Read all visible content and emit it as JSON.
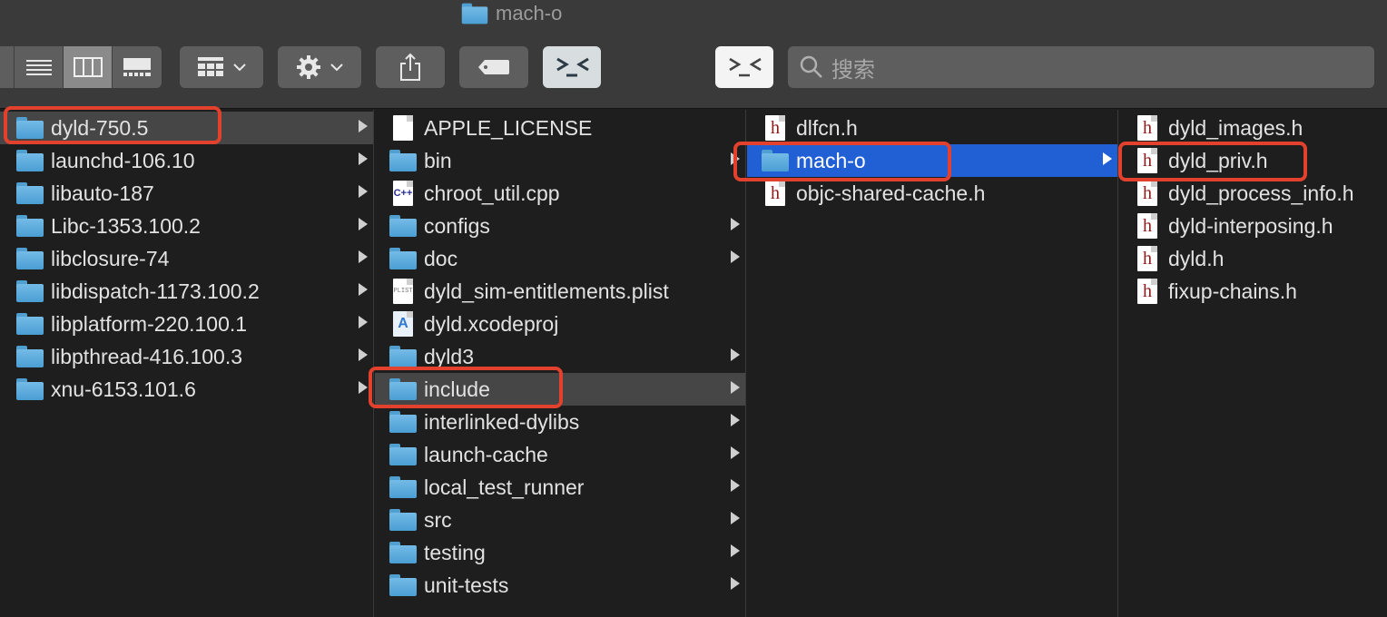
{
  "window": {
    "title": "mach-o"
  },
  "search": {
    "placeholder": "搜索"
  },
  "columns": [
    {
      "items": [
        {
          "label": "dyld-750.5",
          "kind": "folder",
          "state": "grey"
        },
        {
          "label": "launchd-106.10",
          "kind": "folder"
        },
        {
          "label": "libauto-187",
          "kind": "folder"
        },
        {
          "label": "Libc-1353.100.2",
          "kind": "folder"
        },
        {
          "label": "libclosure-74",
          "kind": "folder"
        },
        {
          "label": "libdispatch-1173.100.2",
          "kind": "folder"
        },
        {
          "label": "libplatform-220.100.1",
          "kind": "folder"
        },
        {
          "label": "libpthread-416.100.3",
          "kind": "folder"
        },
        {
          "label": "xnu-6153.101.6",
          "kind": "folder"
        }
      ]
    },
    {
      "items": [
        {
          "label": "APPLE_LICENSE",
          "kind": "file"
        },
        {
          "label": "bin",
          "kind": "folder"
        },
        {
          "label": "chroot_util.cpp",
          "kind": "cpp"
        },
        {
          "label": "configs",
          "kind": "folder"
        },
        {
          "label": "doc",
          "kind": "folder"
        },
        {
          "label": "dyld_sim-entitlements.plist",
          "kind": "plist"
        },
        {
          "label": "dyld.xcodeproj",
          "kind": "xcode"
        },
        {
          "label": "dyld3",
          "kind": "folder"
        },
        {
          "label": "include",
          "kind": "folder",
          "state": "grey"
        },
        {
          "label": "interlinked-dylibs",
          "kind": "folder"
        },
        {
          "label": "launch-cache",
          "kind": "folder"
        },
        {
          "label": "local_test_runner",
          "kind": "folder"
        },
        {
          "label": "src",
          "kind": "folder"
        },
        {
          "label": "testing",
          "kind": "folder"
        },
        {
          "label": "unit-tests",
          "kind": "folder"
        }
      ]
    },
    {
      "items": [
        {
          "label": "dlfcn.h",
          "kind": "header"
        },
        {
          "label": "mach-o",
          "kind": "folder",
          "state": "blue"
        },
        {
          "label": "objc-shared-cache.h",
          "kind": "header"
        }
      ]
    },
    {
      "items": [
        {
          "label": "dyld_images.h",
          "kind": "header"
        },
        {
          "label": "dyld_priv.h",
          "kind": "header"
        },
        {
          "label": "dyld_process_info.h",
          "kind": "header"
        },
        {
          "label": "dyld-interposing.h",
          "kind": "header"
        },
        {
          "label": "dyld.h",
          "kind": "header"
        },
        {
          "label": "fixup-chains.h",
          "kind": "header"
        }
      ]
    }
  ],
  "icons": {
    "header_glyph": "h",
    "cpp_glyph": "C++",
    "plist_glyph": "PLIST",
    "xcode_glyph": "A"
  },
  "colors": {
    "selection_blue": "#2160d4",
    "selection_grey": "#464646",
    "highlight_red": "#e2412e",
    "folder_blue": "#5aa9db"
  }
}
